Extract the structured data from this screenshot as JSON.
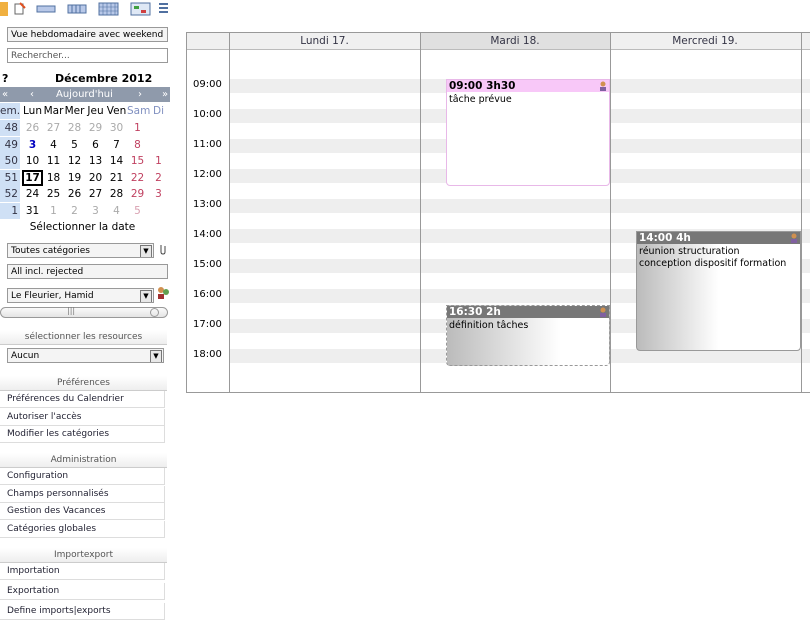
{
  "sidebar": {
    "view_select": "Vue hebdomadaire avec weekend",
    "search_placeholder": "Rechercher...",
    "mini_calendar": {
      "help": "?",
      "month": "Décembre 2012",
      "nav_first": "«",
      "nav_prev": "‹",
      "today": "Aujourd'hui",
      "nav_next": "›",
      "nav_last": "»",
      "weekday_header": [
        "em.",
        "Lun",
        "Mar",
        "Mer",
        "Jeu",
        "Ven",
        "Sam",
        "Di"
      ],
      "weeks": [
        {
          "num": "48",
          "days": [
            "26",
            "27",
            "28",
            "29",
            "30",
            "1",
            ""
          ]
        },
        {
          "num": "49",
          "days": [
            "3",
            "4",
            "5",
            "6",
            "7",
            "8",
            ""
          ]
        },
        {
          "num": "50",
          "days": [
            "10",
            "11",
            "12",
            "13",
            "14",
            "15",
            "1"
          ]
        },
        {
          "num": "51",
          "days": [
            "17",
            "18",
            "19",
            "20",
            "21",
            "22",
            "2"
          ]
        },
        {
          "num": "52",
          "days": [
            "24",
            "25",
            "26",
            "27",
            "28",
            "29",
            "3"
          ]
        },
        {
          "num": "1",
          "days": [
            "31",
            "1",
            "2",
            "3",
            "4",
            "5",
            ""
          ]
        }
      ],
      "select_date": "Sélectionner la date"
    },
    "category_select": "Toutes catégories",
    "status_select": "All incl. rejected",
    "owner_select": "Le Fleurier, Hamid",
    "resources_label": "sélectionner les resources",
    "resources_select": "Aucun",
    "sections": [
      {
        "title": "Préférences",
        "items": [
          "Préférences du Calendrier",
          "Autoriser l'accès",
          "Modifier les catégories"
        ]
      },
      {
        "title": "Administration",
        "items": [
          "Configuration",
          "Champs personnalisés",
          "Gestion des Vacances",
          "Catégories globales"
        ]
      },
      {
        "title": "Importexport",
        "items": [
          "Importation",
          "Exportation",
          "Define imports|exports"
        ]
      }
    ]
  },
  "calendar": {
    "days": [
      "Lundi 17.",
      "Mardi 18.",
      "Mercredi 19."
    ],
    "hours": [
      "09:00",
      "10:00",
      "11:00",
      "12:00",
      "13:00",
      "14:00",
      "15:00",
      "16:00",
      "17:00",
      "18:00"
    ],
    "events": [
      {
        "time": "09:00 3h30",
        "lines": [
          "tâche prévue"
        ],
        "color": "#f8c8f8"
      },
      {
        "time": "16:30 2h",
        "lines": [
          "définition tâches"
        ],
        "color": "#777777"
      },
      {
        "time": "14:00 4h",
        "lines": [
          "réunion structuration",
          "conception dispositif formation"
        ],
        "color": "#777777"
      }
    ]
  },
  "colors": {
    "accent": "#8f9aab",
    "week_col": "#cfe0f5",
    "today_border": "#000000",
    "weekend_text": "#c04060"
  }
}
